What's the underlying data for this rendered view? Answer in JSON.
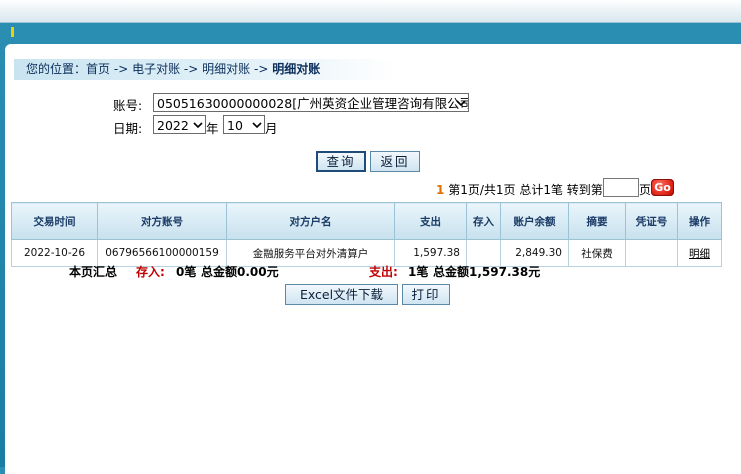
{
  "breadcrumb": {
    "prefix": "您的位置：",
    "items": [
      "首页",
      "电子对账",
      "明细对账",
      "明细对账"
    ],
    "separator": "->"
  },
  "form": {
    "account_label": "账号:",
    "account_value": "05051630000000028[广州英资企业管理咨询有限公司]",
    "date_label": "日期:",
    "year_value": "2022",
    "year_unit": "年",
    "month_value": "10",
    "month_unit": "月"
  },
  "buttons": {
    "query": "查询",
    "back": "返回",
    "excel": "Excel文件下载",
    "print": "打印",
    "go": "Go"
  },
  "pager": {
    "current": "1",
    "info": "第1页/共1页 总计1笔 转到第",
    "unit": "页"
  },
  "table": {
    "headers": [
      "交易时间",
      "对方账号",
      "对方户名",
      "支出",
      "存入",
      "账户余额",
      "摘要",
      "凭证号",
      "操作"
    ],
    "rows": [
      [
        "2022-10-26",
        "06796566100000159",
        "金融服务平台对外清算户",
        "1,597.38",
        "",
        "2,849.30",
        "社保费",
        "",
        "明细"
      ]
    ]
  },
  "summary": {
    "label": "本页汇总",
    "deposit_label": "存入:",
    "deposit_count": "0笔",
    "deposit_total_label": "总金额0.00元",
    "expense_label": "支出:",
    "expense_count": "1笔",
    "expense_total_label": "总金额1,597.38元"
  },
  "colors": {
    "accent": "#1a7ea3",
    "header_bg": "#c7e1ee",
    "red": "#c00000"
  }
}
